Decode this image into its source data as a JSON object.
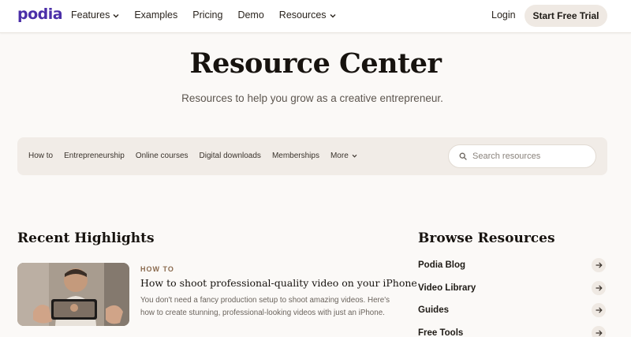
{
  "header": {
    "logo": "podia",
    "nav": [
      {
        "label": "Features",
        "has_dropdown": true
      },
      {
        "label": "Examples",
        "has_dropdown": false
      },
      {
        "label": "Pricing",
        "has_dropdown": false
      },
      {
        "label": "Demo",
        "has_dropdown": false
      },
      {
        "label": "Resources",
        "has_dropdown": true
      }
    ],
    "login": "Login",
    "cta": "Start Free Trial"
  },
  "hero": {
    "title": "Resource Center",
    "subtitle": "Resources to help you grow as a creative entrepreneur."
  },
  "filters": {
    "tabs": [
      "How to",
      "Entrepreneurship",
      "Online courses",
      "Digital downloads",
      "Memberships"
    ],
    "more_label": "More",
    "search_placeholder": "Search resources"
  },
  "recent": {
    "title": "Recent Highlights",
    "card": {
      "kicker": "HOW TO",
      "title": "How to shoot professional-quality video on your iPhone",
      "description": "You don't need a fancy production setup to shoot amazing videos. Here's how to create stunning, professional-looking videos with just an iPhone."
    }
  },
  "browse": {
    "title": "Browse Resources",
    "items": [
      "Podia Blog",
      "Video Library",
      "Guides",
      "Free Tools"
    ]
  },
  "colors": {
    "brand": "#4b2fa8",
    "background": "#fbf9f7",
    "pill": "#efe9e3"
  },
  "icons": [
    "chevron-down-icon",
    "search-icon",
    "arrow-right-icon"
  ]
}
